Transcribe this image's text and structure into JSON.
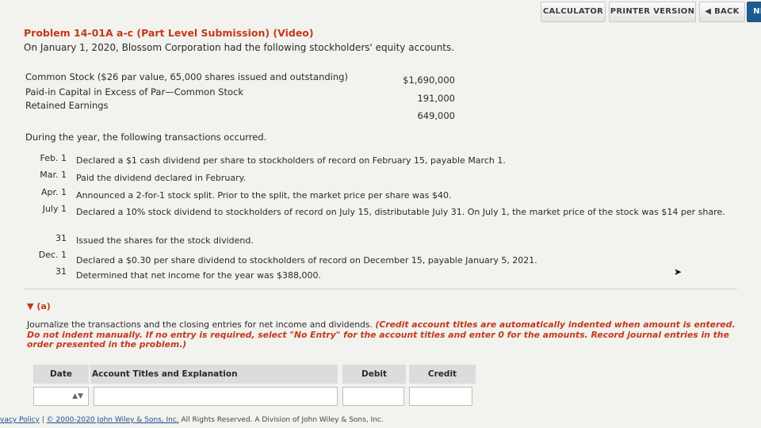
{
  "toolbar": {
    "calculator": "CALCULATOR",
    "printer_version": "PRINTER VERSION",
    "back": "BACK",
    "next": "NE"
  },
  "problem": {
    "title": "Problem 14-01A a-c (Part Level Submission) (Video)",
    "intro": "On January 1, 2020, Blossom Corporation had the following stockholders' equity accounts."
  },
  "accounts": [
    {
      "label": "Common Stock ($26 par value, 65,000 shares issued and outstanding)",
      "amount": "$1,690,000"
    },
    {
      "label": "Paid-in Capital in Excess of Par—Common Stock",
      "amount": "191,000"
    },
    {
      "label": "Retained Earnings",
      "amount": "649,000"
    }
  ],
  "during": "During the year, the following transactions occurred.",
  "transactions": [
    {
      "date": "Feb. 1",
      "text": "Declared a $1 cash dividend per share to stockholders of record on February 15, payable March 1."
    },
    {
      "date": "Mar. 1",
      "text": "Paid the dividend declared in February."
    },
    {
      "date": "Apr. 1",
      "text": "Announced a 2-for-1 stock split. Prior to the split, the market price per share was $40."
    },
    {
      "date": "July 1",
      "text": "Declared a 10% stock dividend to stockholders of record on July 15, distributable July 31. On July 1, the market price of the stock was $14 per share."
    },
    {
      "date": "31",
      "text": "Issued the shares for the stock dividend."
    },
    {
      "date": "Dec. 1",
      "text": "Declared a $0.30 per share dividend to stockholders of record on December 15, payable January 5, 2021."
    },
    {
      "date": "31",
      "text": "Determined that net income for the year was $388,000."
    }
  ],
  "part_a": {
    "label": "(a)",
    "instruction": "Journalize the transactions and the closing entries for net income and dividends.",
    "instruction_red": "(Credit account titles are automatically indented when amount is entered. Do not indent manually. If no entry is required, select \"No Entry\" for the account titles and enter 0 for the amounts. Record journal entries in the order presented in the problem.)"
  },
  "journal": {
    "headers": {
      "date": "Date",
      "account": "Account Titles and Explanation",
      "debit": "Debit",
      "credit": "Credit"
    },
    "row": {
      "date": "",
      "account": "",
      "debit": "",
      "credit": ""
    }
  },
  "footer": {
    "privacy": "vacy Policy",
    "sep": " | ",
    "copyright": "© 2000-2020 John Wiley & Sons, Inc.",
    "rights": " All Rights Reserved. A Division of John Wiley & Sons, Inc."
  },
  "colors": {
    "accent_red": "#c23a1a",
    "link_blue": "#1f4f8a",
    "next_button": "#1f5a8f"
  }
}
